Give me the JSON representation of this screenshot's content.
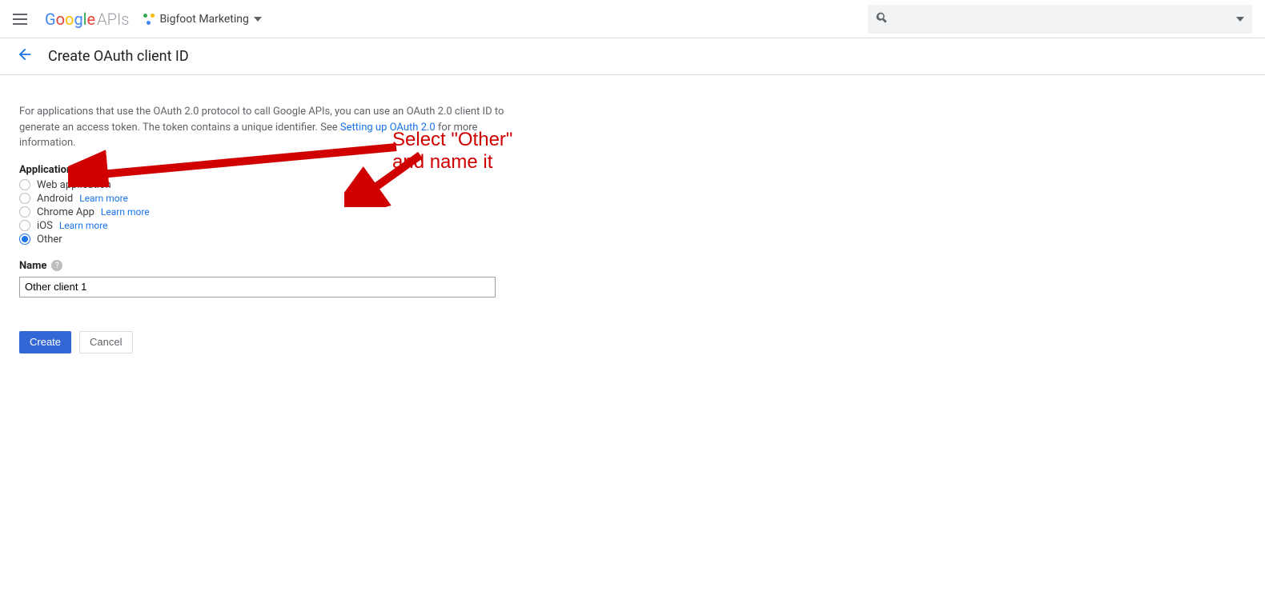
{
  "header": {
    "logo_main": "Google",
    "logo_suffix": "APIs",
    "project_name": "Bigfoot Marketing",
    "search_placeholder": ""
  },
  "subheader": {
    "title": "Create OAuth client ID"
  },
  "content": {
    "info_text_pre": "For applications that use the OAuth 2.0 protocol to call Google APIs, you can use an OAuth 2.0 client ID to generate an access token. The token contains a unique identifier. See ",
    "info_link": "Setting up OAuth 2.0",
    "info_text_post": " for more information.",
    "app_type_label": "Application type",
    "radios": [
      {
        "label": "Web application",
        "learn_more": "",
        "selected": false
      },
      {
        "label": "Android",
        "learn_more": "Learn more",
        "selected": false
      },
      {
        "label": "Chrome App",
        "learn_more": "Learn more",
        "selected": false
      },
      {
        "label": "iOS",
        "learn_more": "Learn more",
        "selected": false
      },
      {
        "label": "Other",
        "learn_more": "",
        "selected": true
      }
    ],
    "name_label": "Name",
    "name_value": "Other client 1",
    "create_button": "Create",
    "cancel_button": "Cancel"
  },
  "annotation": {
    "text": "Select \"Other\" and name it"
  }
}
